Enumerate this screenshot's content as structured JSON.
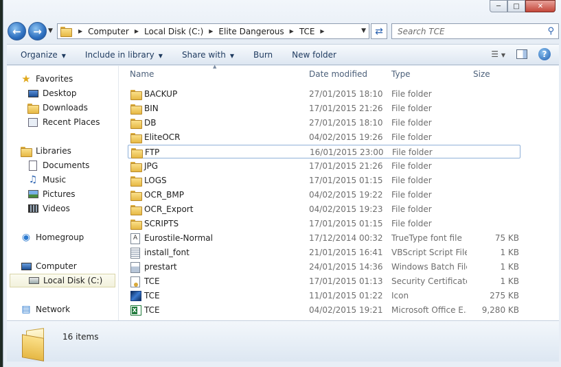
{
  "window": {
    "caption_buttons": [
      "minimize",
      "maximize",
      "close"
    ]
  },
  "address_bar": {
    "crumbs": [
      "Computer",
      "Local Disk (C:)",
      "Elite Dangerous",
      "TCE"
    ]
  },
  "search": {
    "placeholder": "Search TCE"
  },
  "toolbar": {
    "organize": "Organize",
    "include_in_library": "Include in library",
    "share_with": "Share with",
    "burn": "Burn",
    "new_folder": "New folder"
  },
  "nav_pane": {
    "favorites": "Favorites",
    "desktop": "Desktop",
    "downloads": "Downloads",
    "recent_places": "Recent Places",
    "libraries": "Libraries",
    "documents": "Documents",
    "music": "Music",
    "pictures": "Pictures",
    "videos": "Videos",
    "homegroup": "Homegroup",
    "computer": "Computer",
    "local_disk": "Local Disk (C:)",
    "network": "Network"
  },
  "columns": {
    "name": "Name",
    "date_modified": "Date modified",
    "type": "Type",
    "size": "Size"
  },
  "files": [
    {
      "name": "BACKUP",
      "date": "27/01/2015 18:10",
      "type": "File folder",
      "size": "",
      "icon": "folder-icon"
    },
    {
      "name": "BIN",
      "date": "17/01/2015 21:26",
      "type": "File folder",
      "size": "",
      "icon": "folder-icon"
    },
    {
      "name": "DB",
      "date": "27/01/2015 18:10",
      "type": "File folder",
      "size": "",
      "icon": "folder-icon"
    },
    {
      "name": "EliteOCR",
      "date": "04/02/2015 19:26",
      "type": "File folder",
      "size": "",
      "icon": "folder-icon"
    },
    {
      "name": "FTP",
      "date": "16/01/2015 23:00",
      "type": "File folder",
      "size": "",
      "icon": "folder-icon"
    },
    {
      "name": "JPG",
      "date": "17/01/2015 21:26",
      "type": "File folder",
      "size": "",
      "icon": "folder-icon"
    },
    {
      "name": "LOGS",
      "date": "17/01/2015 01:15",
      "type": "File folder",
      "size": "",
      "icon": "folder-icon"
    },
    {
      "name": "OCR_BMP",
      "date": "04/02/2015 19:22",
      "type": "File folder",
      "size": "",
      "icon": "folder-icon"
    },
    {
      "name": "OCR_Export",
      "date": "04/02/2015 19:23",
      "type": "File folder",
      "size": "",
      "icon": "folder-icon"
    },
    {
      "name": "SCRIPTS",
      "date": "17/01/2015 01:15",
      "type": "File folder",
      "size": "",
      "icon": "folder-icon"
    },
    {
      "name": "Eurostile-Normal",
      "date": "17/12/2014 00:32",
      "type": "TrueType font file",
      "size": "75 KB",
      "icon": "font-file-icon"
    },
    {
      "name": "install_font",
      "date": "21/01/2015 16:41",
      "type": "VBScript Script File",
      "size": "1 KB",
      "icon": "script-file-icon"
    },
    {
      "name": "prestart",
      "date": "24/01/2015 14:36",
      "type": "Windows Batch File",
      "size": "1 KB",
      "icon": "batch-file-icon"
    },
    {
      "name": "TCE",
      "date": "17/01/2015 01:13",
      "type": "Security Certificate",
      "size": "1 KB",
      "icon": "certificate-icon"
    },
    {
      "name": "TCE",
      "date": "11/01/2015 01:22",
      "type": "Icon",
      "size": "275 KB",
      "icon": "image-icon"
    },
    {
      "name": "TCE",
      "date": "04/02/2015 19:21",
      "type": "Microsoft Office E...",
      "size": "9,280 KB",
      "icon": "excel-icon"
    }
  ],
  "status": {
    "item_count": "16 items"
  },
  "colors": {
    "link_text": "#1e3a5f",
    "secondary_text": "#6d6d6d",
    "header_text": "#4c607a",
    "focus_border": "#8fb0d8"
  }
}
